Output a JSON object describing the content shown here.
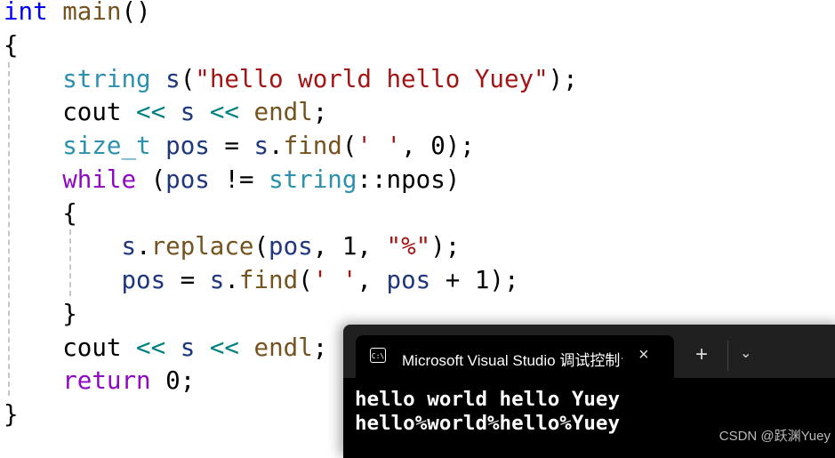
{
  "editor": {
    "lines": [
      [
        [
          "int",
          "kw"
        ],
        [
          " ",
          "pl"
        ],
        [
          "main",
          "fn"
        ],
        [
          "()",
          "pl"
        ]
      ],
      [
        [
          "{",
          "pl"
        ]
      ],
      [
        [
          "    ",
          "pl"
        ],
        [
          "string",
          "ty"
        ],
        [
          " ",
          "pl"
        ],
        [
          "s",
          "var"
        ],
        [
          "(",
          "pl"
        ],
        [
          "\"hello world hello Yuey\"",
          "str"
        ],
        [
          ");",
          "pl"
        ]
      ],
      [
        [
          "    ",
          "pl"
        ],
        [
          "cout",
          "pl"
        ],
        [
          " ",
          "pl"
        ],
        [
          "<<",
          "op"
        ],
        [
          " ",
          "pl"
        ],
        [
          "s",
          "var"
        ],
        [
          " ",
          "pl"
        ],
        [
          "<<",
          "op"
        ],
        [
          " ",
          "pl"
        ],
        [
          "endl",
          "fn"
        ],
        [
          ";",
          "pl"
        ]
      ],
      [
        [
          "    ",
          "pl"
        ],
        [
          "size_t",
          "ty"
        ],
        [
          " ",
          "pl"
        ],
        [
          "pos",
          "var"
        ],
        [
          " = ",
          "pl"
        ],
        [
          "s",
          "var"
        ],
        [
          ".",
          "pl"
        ],
        [
          "find",
          "fn"
        ],
        [
          "(",
          "pl"
        ],
        [
          "' '",
          "str"
        ],
        [
          ", 0);",
          "pl"
        ]
      ],
      [
        [
          "    ",
          "pl"
        ],
        [
          "while",
          "ctl"
        ],
        [
          " (",
          "pl"
        ],
        [
          "pos",
          "var"
        ],
        [
          " != ",
          "pl"
        ],
        [
          "string",
          "ty"
        ],
        [
          "::npos)",
          "pl"
        ]
      ],
      [
        [
          "    {",
          "pl"
        ]
      ],
      [
        [
          "        ",
          "pl"
        ],
        [
          "s",
          "var"
        ],
        [
          ".",
          "pl"
        ],
        [
          "replace",
          "fn"
        ],
        [
          "(",
          "pl"
        ],
        [
          "pos",
          "var"
        ],
        [
          ", 1, ",
          "pl"
        ],
        [
          "\"%\"",
          "str"
        ],
        [
          ");",
          "pl"
        ]
      ],
      [
        [
          "        ",
          "pl"
        ],
        [
          "pos",
          "var"
        ],
        [
          " = ",
          "pl"
        ],
        [
          "s",
          "var"
        ],
        [
          ".",
          "pl"
        ],
        [
          "find",
          "fn"
        ],
        [
          "(",
          "pl"
        ],
        [
          "' '",
          "str"
        ],
        [
          ", ",
          "pl"
        ],
        [
          "pos",
          "var"
        ],
        [
          " + 1);",
          "pl"
        ]
      ],
      [
        [
          "    }",
          "pl"
        ]
      ],
      [
        [
          "    ",
          "pl"
        ],
        [
          "cout",
          "pl"
        ],
        [
          " ",
          "pl"
        ],
        [
          "<<",
          "op"
        ],
        [
          " ",
          "pl"
        ],
        [
          "s",
          "var"
        ],
        [
          " ",
          "pl"
        ],
        [
          "<<",
          "op"
        ],
        [
          " ",
          "pl"
        ],
        [
          "endl",
          "fn"
        ],
        [
          ";",
          "pl"
        ]
      ],
      [
        [
          "    ",
          "pl"
        ],
        [
          "return",
          "ctl"
        ],
        [
          " 0;",
          "pl"
        ]
      ],
      [
        [
          "}",
          "pl"
        ]
      ]
    ],
    "colors": {
      "keyword": "#0000ff",
      "function": "#74531f",
      "type": "#2b91af",
      "string": "#a31515",
      "variable": "#1f377f",
      "operator": "#008080",
      "control": "#8f08c4"
    }
  },
  "terminal": {
    "tab_icon": "console-icon",
    "tab_icon_text": "C:\\",
    "tab_title": "Microsoft Visual Studio 调试控制台",
    "close_icon": "×",
    "new_tab_icon": "+",
    "dropdown_icon": "⌄",
    "output": [
      "hello world hello Yuey",
      "hello%world%hello%Yuey"
    ]
  },
  "watermark": "CSDN @跃渊Yuey"
}
